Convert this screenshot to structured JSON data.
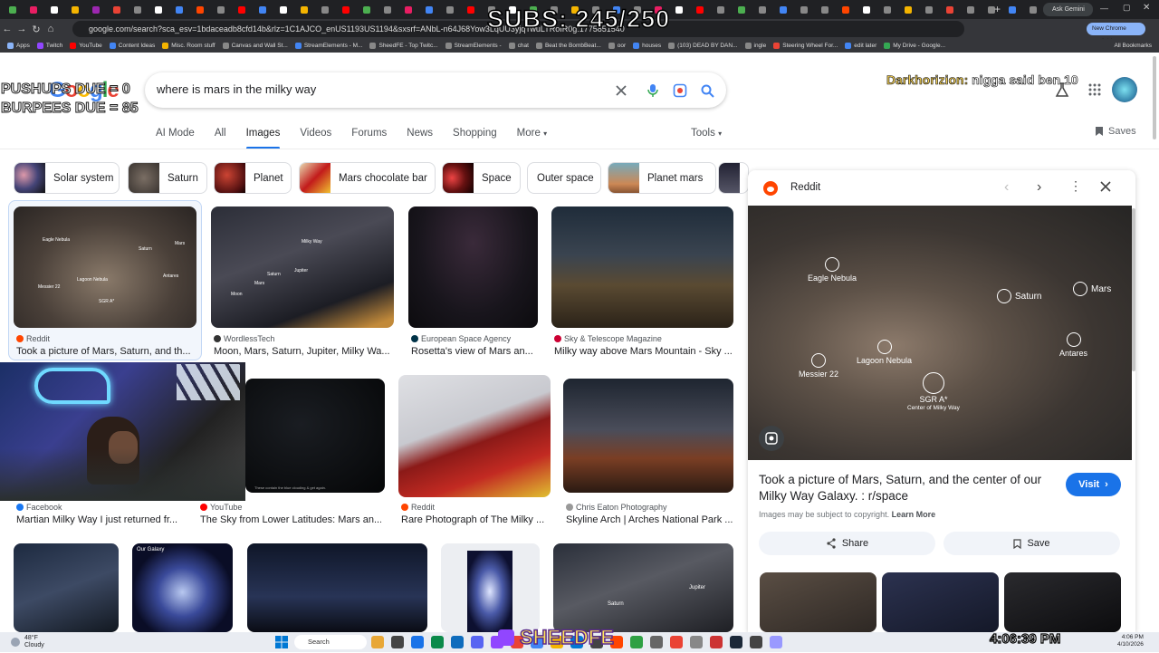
{
  "overlay": {
    "subs": "SUBS: 245/250",
    "push_label": "PUSHUPS DUE = 0",
    "burpees_label": "BURPEES DUE = 85",
    "chat_user": "Darkhorizion:",
    "chat_message": "nigga said ben 10",
    "brand": "SHEEDFE",
    "clock_big": "4:06:39 PM"
  },
  "browser": {
    "url": "google.com/search?sca_esv=1bdaceadb8cfd14b&rlz=1C1AJCO_enUS1193US1194&sxsrf=ANbL-n64J68Yow3LqUU3yjqTwuLTRoIR0g:1775851540",
    "ask_gemini": "Ask Gemini",
    "new_chrome": "New Chrome available",
    "apps_label": "Apps",
    "all_bookmarks": "All Bookmarks",
    "bookmarks": [
      "Twitch",
      "YouTube",
      "Content Ideas",
      "Misc. Room stuff",
      "Canvas and Wall St...",
      "StreamElements - M...",
      "SheedFE - Top Twitc...",
      "StreamElements -",
      "chat",
      "Beat the BombBeat...",
      "oor",
      "houses",
      "(103) DEAD BY DAN...",
      "ingle",
      "Steering Wheel For...",
      "edit later",
      "My Drive - Google..."
    ]
  },
  "search": {
    "query": "where is mars in the milky way",
    "tabs": [
      "AI Mode",
      "All",
      "Images",
      "Videos",
      "Forums",
      "News",
      "Shopping",
      "More"
    ],
    "tools": "Tools",
    "saves": "Saves",
    "chips": [
      "Solar system",
      "Saturn",
      "Planet",
      "Mars chocolate bar",
      "Space",
      "Outer space",
      "Planet mars"
    ]
  },
  "results": [
    {
      "source": "Reddit",
      "title": "Took a picture of Mars, Saturn, and th..."
    },
    {
      "source": "WordlessTech",
      "title": "Moon, Mars, Saturn, Jupiter, Milky Wa..."
    },
    {
      "source": "European Space Agency",
      "title": "Rosetta's view of Mars an..."
    },
    {
      "source": "Sky & Telescope Magazine",
      "title": "Milky way above Mars Mountain - Sky ..."
    },
    {
      "source": "Facebook",
      "title": "Martian Milky Way I just returned fr..."
    },
    {
      "source": "YouTube",
      "title": "The Sky from Lower Latitudes: Mars an..."
    },
    {
      "source": "Reddit",
      "title": "Rare Photograph of The Milky ..."
    },
    {
      "source": "Chris Eaton Photography",
      "title": "Skyline Arch | Arches National Park ..."
    }
  ],
  "img_labels": {
    "r1": [
      "Eagle Nebula",
      "Saturn",
      "Mars",
      "Lagoon Nebula",
      "Antares",
      "Messier 22",
      "SGR A*"
    ],
    "r2": [
      "Milky Way",
      "Saturn",
      "Jupiter",
      "Mars",
      "Moon"
    ],
    "bottom": [
      "Our Galaxy",
      "Saturn",
      "Jupiter"
    ]
  },
  "panel": {
    "source": "Reddit",
    "title": "Took a picture of Mars, Saturn, and the center of our Milky Way Galaxy. : r/space",
    "copyright": "Images may be subject to copyright.",
    "learn_more": "Learn More",
    "visit": "Visit",
    "share": "Share",
    "save": "Save",
    "labels": {
      "eagle": "Eagle Nebula",
      "saturn": "Saturn",
      "mars": "Mars",
      "lagoon": "Lagoon Nebula",
      "antares": "Antares",
      "messier": "Messier 22",
      "sgr": "SGR A*",
      "center": "Center of Milky Way"
    }
  },
  "webcam_caption": "These contain the blue clouding & get again.",
  "taskbar": {
    "weather_temp": "48°F",
    "weather_desc": "Cloudy",
    "search": "Search",
    "time": "4:06 PM",
    "date": "4/10/2026"
  }
}
